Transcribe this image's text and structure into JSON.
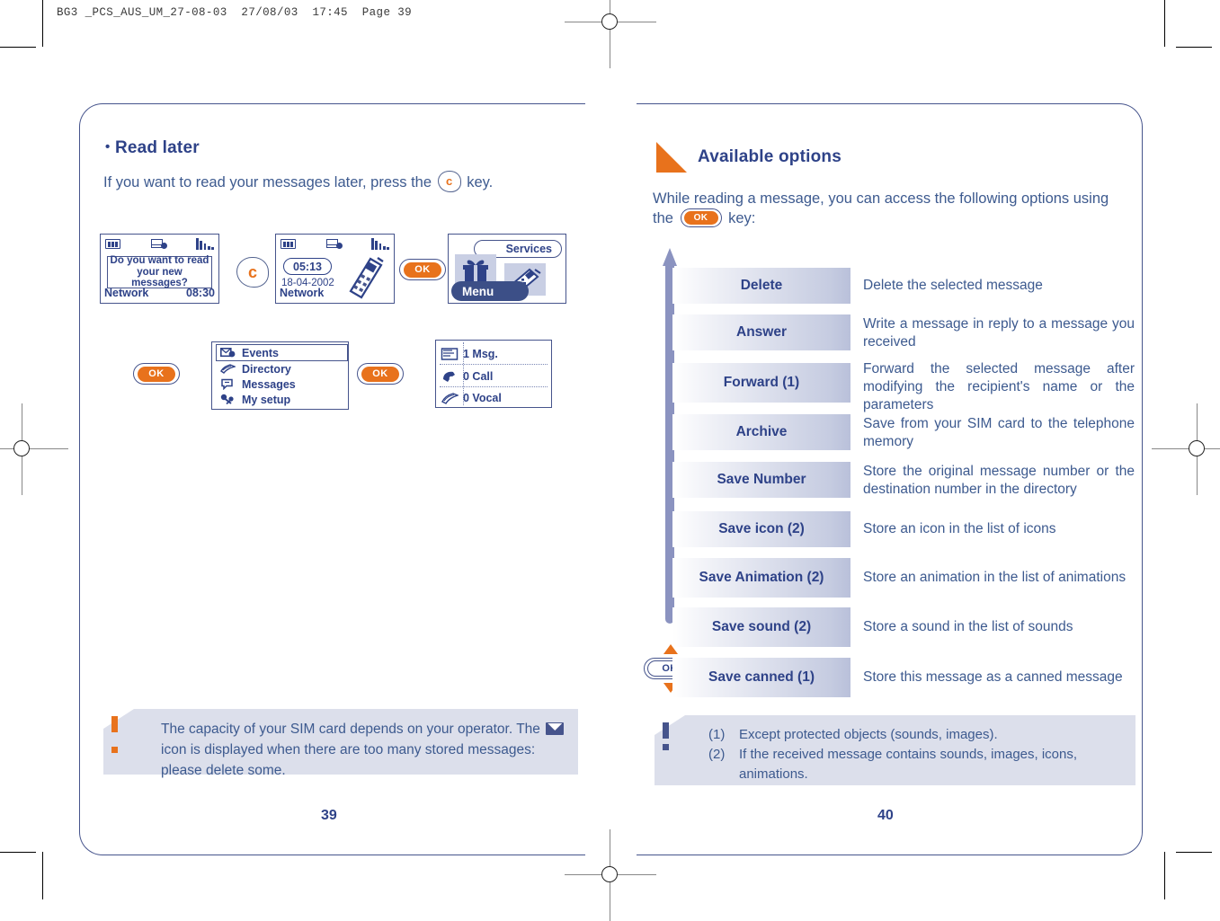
{
  "print_header": "BG3 _PCS_AUS_UM_27-08-03  27/08/03  17:45  Page 39",
  "left_page": {
    "page_number": "39",
    "heading": "Read later",
    "bullet": "•",
    "intro_before": "If you want to read your messages later, press the",
    "key_c_label": "c",
    "intro_after": "key.",
    "screens": {
      "screen1": {
        "message": "Do you want to read your new messages?",
        "network": "Network",
        "time": "08:30"
      },
      "screen2": {
        "clock": "05:13",
        "date": "18-04-2002",
        "network": "Network"
      },
      "screen3": {
        "services": "Services",
        "menu": "Menu"
      },
      "screen4": {
        "items": [
          {
            "label": "Events",
            "icon": "envelope-icon",
            "selected": true
          },
          {
            "label": "Directory",
            "icon": "book-icon",
            "selected": false
          },
          {
            "label": "Messages",
            "icon": "message-icon",
            "selected": false
          },
          {
            "label": "My setup",
            "icon": "tools-icon",
            "selected": false
          }
        ]
      },
      "screen5": {
        "items": [
          {
            "label": "1 Msg.",
            "icon": "message-icon",
            "selected": true
          },
          {
            "label": "0 Call",
            "icon": "handset-icon",
            "selected": false
          },
          {
            "label": "0 Vocal",
            "icon": "voicemail-icon",
            "selected": false
          }
        ]
      }
    },
    "ok_key_label": "OK",
    "note": {
      "line1": "The capacity of your SIM card depends on your operator.",
      "line2_before": "The",
      "line2_after": "icon is displayed when there are too many stored",
      "line3": "messages: please delete some."
    }
  },
  "right_page": {
    "page_number": "40",
    "section_title": "Available options",
    "intro_before": "While reading a message, you can access the following options using",
    "intro_line2_before": "the",
    "intro_line2_after": "key:",
    "ok_key_label": "OK",
    "nav_key_label": "OK",
    "options": [
      {
        "name": "Delete",
        "description": "Delete the selected message"
      },
      {
        "name": "Answer",
        "description": "Write a message in reply to a message you received"
      },
      {
        "name": "Forward (1)",
        "description": "Forward the selected message after modifying the recipient's name or the parameters"
      },
      {
        "name": "Archive",
        "description": "Save from your SIM card to the telephone memory"
      },
      {
        "name": "Save Number",
        "description": "Store the original message number or the destination number in the directory"
      },
      {
        "name": "Save icon (2)",
        "description": "Store an icon in the list of icons"
      },
      {
        "name": "Save Animation (2)",
        "description": "Store an animation in the list of animations"
      },
      {
        "name": "Save sound (2)",
        "description": "Store a sound in the list of sounds"
      },
      {
        "name": "Save canned (1)",
        "description": "Store this message as a canned message"
      }
    ],
    "footnotes": [
      {
        "num": "(1)",
        "text": "Except protected objects (sounds, images)."
      },
      {
        "num": "(2)",
        "text": "If the received message contains sounds, images, icons, animations."
      }
    ]
  },
  "colors": {
    "ink_blue": "#2e4288",
    "body_blue": "#3d5a8f",
    "accent_orange": "#e8721c",
    "panel_border": "#46548c",
    "note_bg": "#dcdfeb",
    "label_grad_end": "#b9c0da"
  }
}
